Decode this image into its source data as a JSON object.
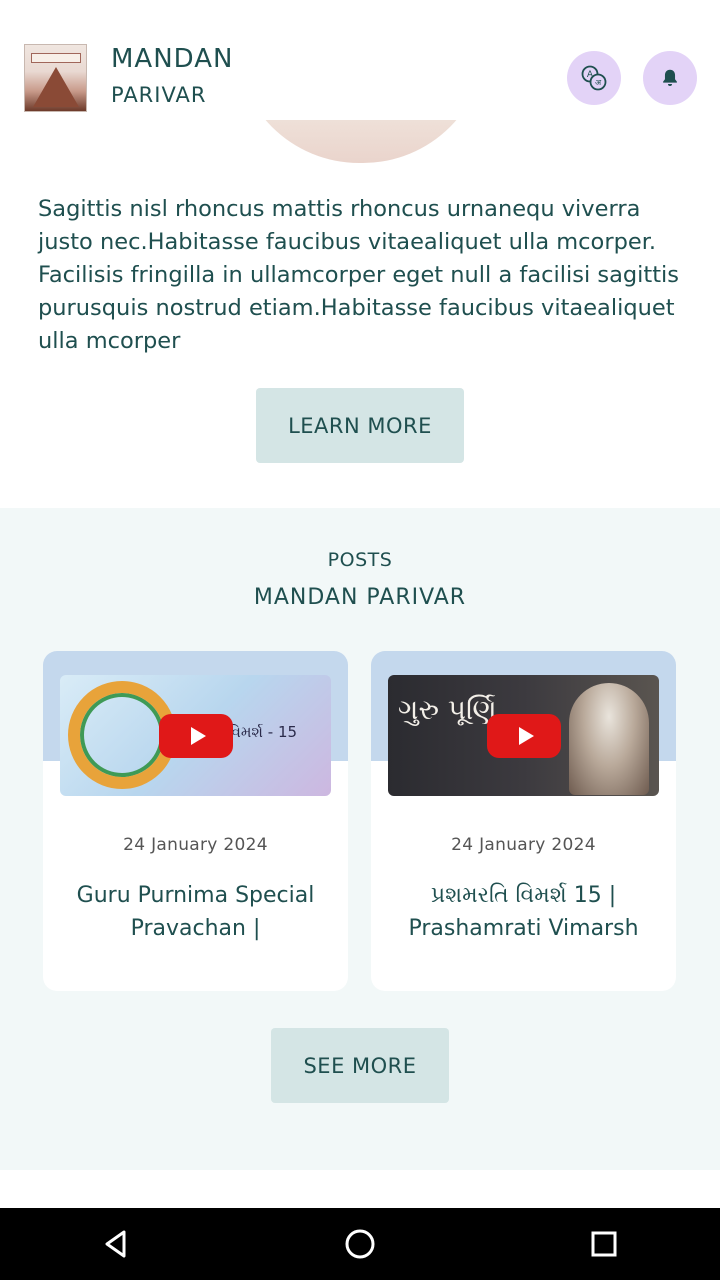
{
  "header": {
    "brand_title": "MANDAN",
    "brand_subtitle": "PARIVAR",
    "translate_icon": "translate-icon",
    "bell_icon": "bell-icon"
  },
  "about": {
    "text": "Sagittis nisl rhoncus mattis rhoncus urnanequ viverra justo nec.Habitasse faucibus vitaealiquet ulla mcorper. Facilisis fringilla in ullamcorper eget null a facilisi sagittis purusquis nostrud etiam.Habitasse faucibus vitaealiquet ulla mcorper",
    "learn_more_label": "LEARN MORE"
  },
  "posts": {
    "label": "POSTS",
    "title": "MANDAN PARIVAR",
    "items": [
      {
        "thumb_text": "તિ વિમર્શ - 15",
        "date": "24 January 2024",
        "title": "Guru Purnima Special Pravachan |"
      },
      {
        "thumb_text": "ગુરુ પૂર્ણિ",
        "date": "24 January 2024",
        "title": "પ્રશમરતિ વિમર્શ 15 | Prashamrati Vimarsh"
      }
    ],
    "see_more_label": "SEE MORE"
  },
  "colors": {
    "primary_text": "#1f4f4f",
    "button_bg": "#d4e5e5",
    "icon_circle_bg": "#e3d3f7",
    "section_bg": "#f2f8f8",
    "youtube_red": "#e01818"
  }
}
